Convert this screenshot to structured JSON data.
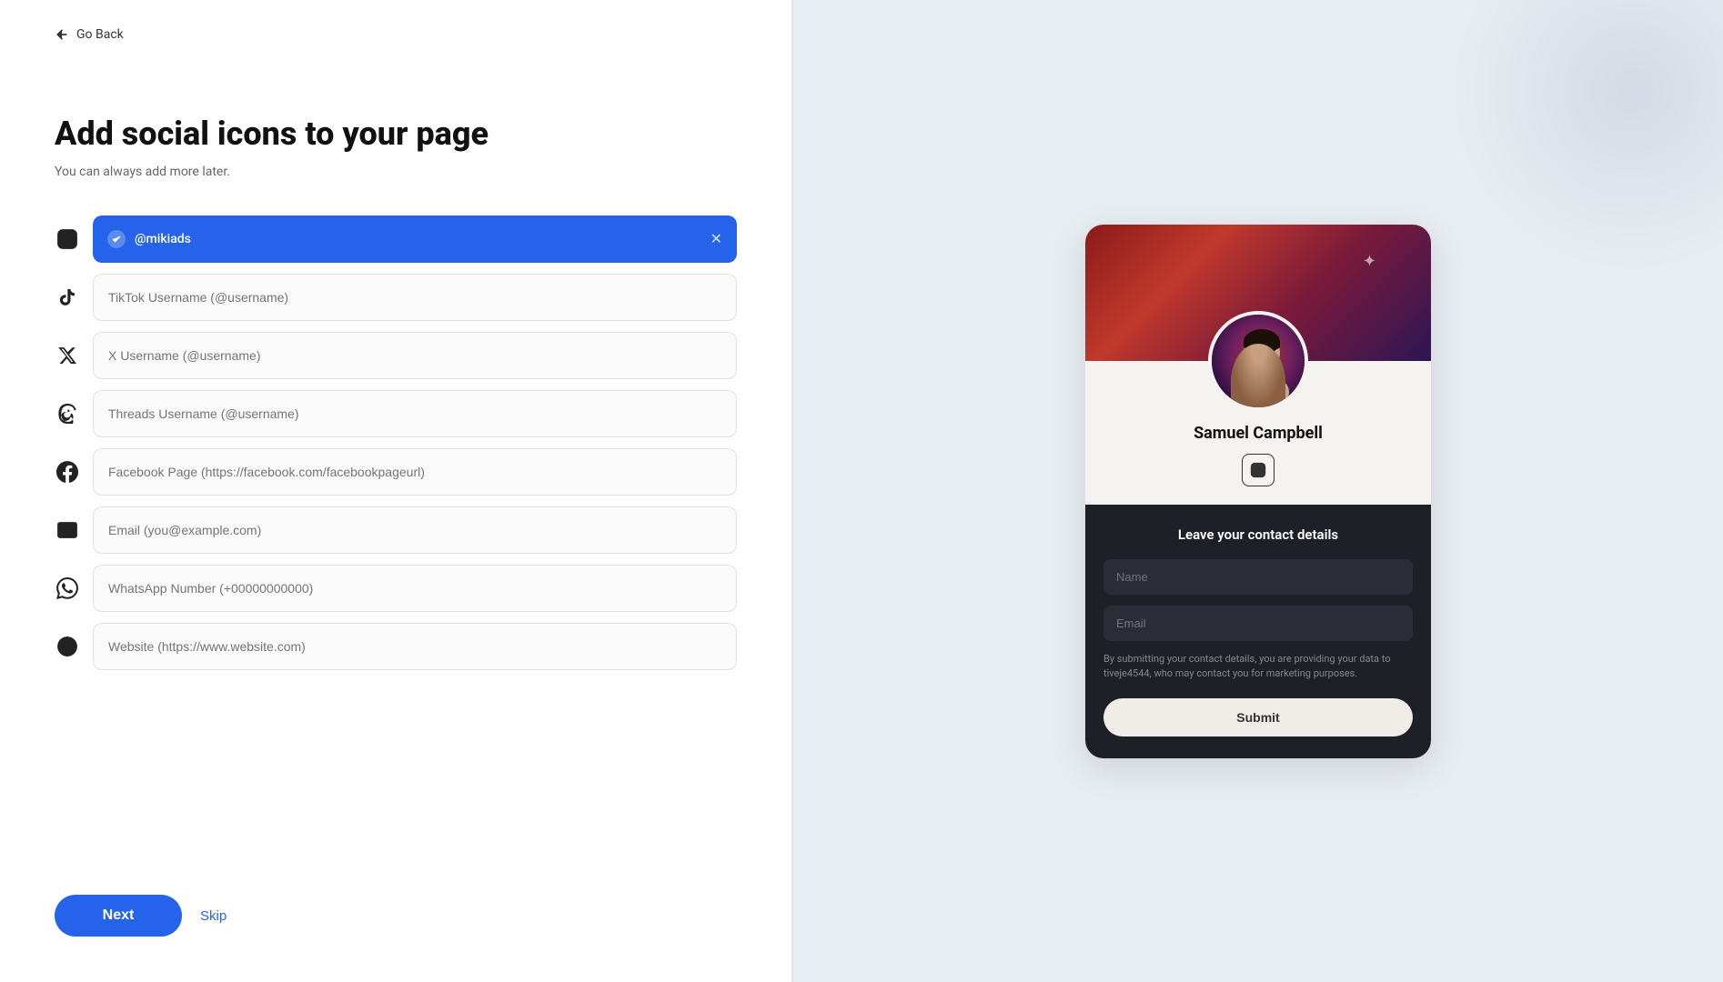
{
  "nav": {
    "go_back_label": "Go Back"
  },
  "header": {
    "title": "Add social icons to your page",
    "subtitle": "You can always add more later."
  },
  "social_fields": [
    {
      "id": "instagram",
      "icon": "instagram-icon",
      "placeholder": "@mikiads",
      "active": true,
      "value": "@mikiads"
    },
    {
      "id": "tiktok",
      "icon": "tiktok-icon",
      "placeholder": "TikTok Username (@username)",
      "active": false,
      "value": ""
    },
    {
      "id": "x",
      "icon": "x-icon",
      "placeholder": "X Username (@username)",
      "active": false,
      "value": ""
    },
    {
      "id": "threads",
      "icon": "threads-icon",
      "placeholder": "Threads Username (@username)",
      "active": false,
      "value": ""
    },
    {
      "id": "facebook",
      "icon": "facebook-icon",
      "placeholder": "Facebook Page (https://facebook.com/facebookpageurl)",
      "active": false,
      "value": ""
    },
    {
      "id": "email",
      "icon": "email-icon",
      "placeholder": "Email (you@example.com)",
      "active": false,
      "value": ""
    },
    {
      "id": "whatsapp",
      "icon": "whatsapp-icon",
      "placeholder": "WhatsApp Number (+00000000000)",
      "active": false,
      "value": ""
    },
    {
      "id": "website",
      "icon": "website-icon",
      "placeholder": "Website (https://www.website.com)",
      "active": false,
      "value": ""
    }
  ],
  "actions": {
    "next_label": "Next",
    "skip_label": "Skip"
  },
  "preview": {
    "profile_name": "Samuel Campbell",
    "contact_section_title": "Leave your contact details",
    "name_placeholder": "Name",
    "email_placeholder": "Email",
    "disclaimer": "By submitting your contact details, you are providing your data to tiveje4544, who may contact you for marketing purposes.",
    "submit_label": "Submit"
  },
  "colors": {
    "accent": "#2563eb",
    "active_bg": "#2563eb",
    "dark_section": "#1e2028"
  }
}
